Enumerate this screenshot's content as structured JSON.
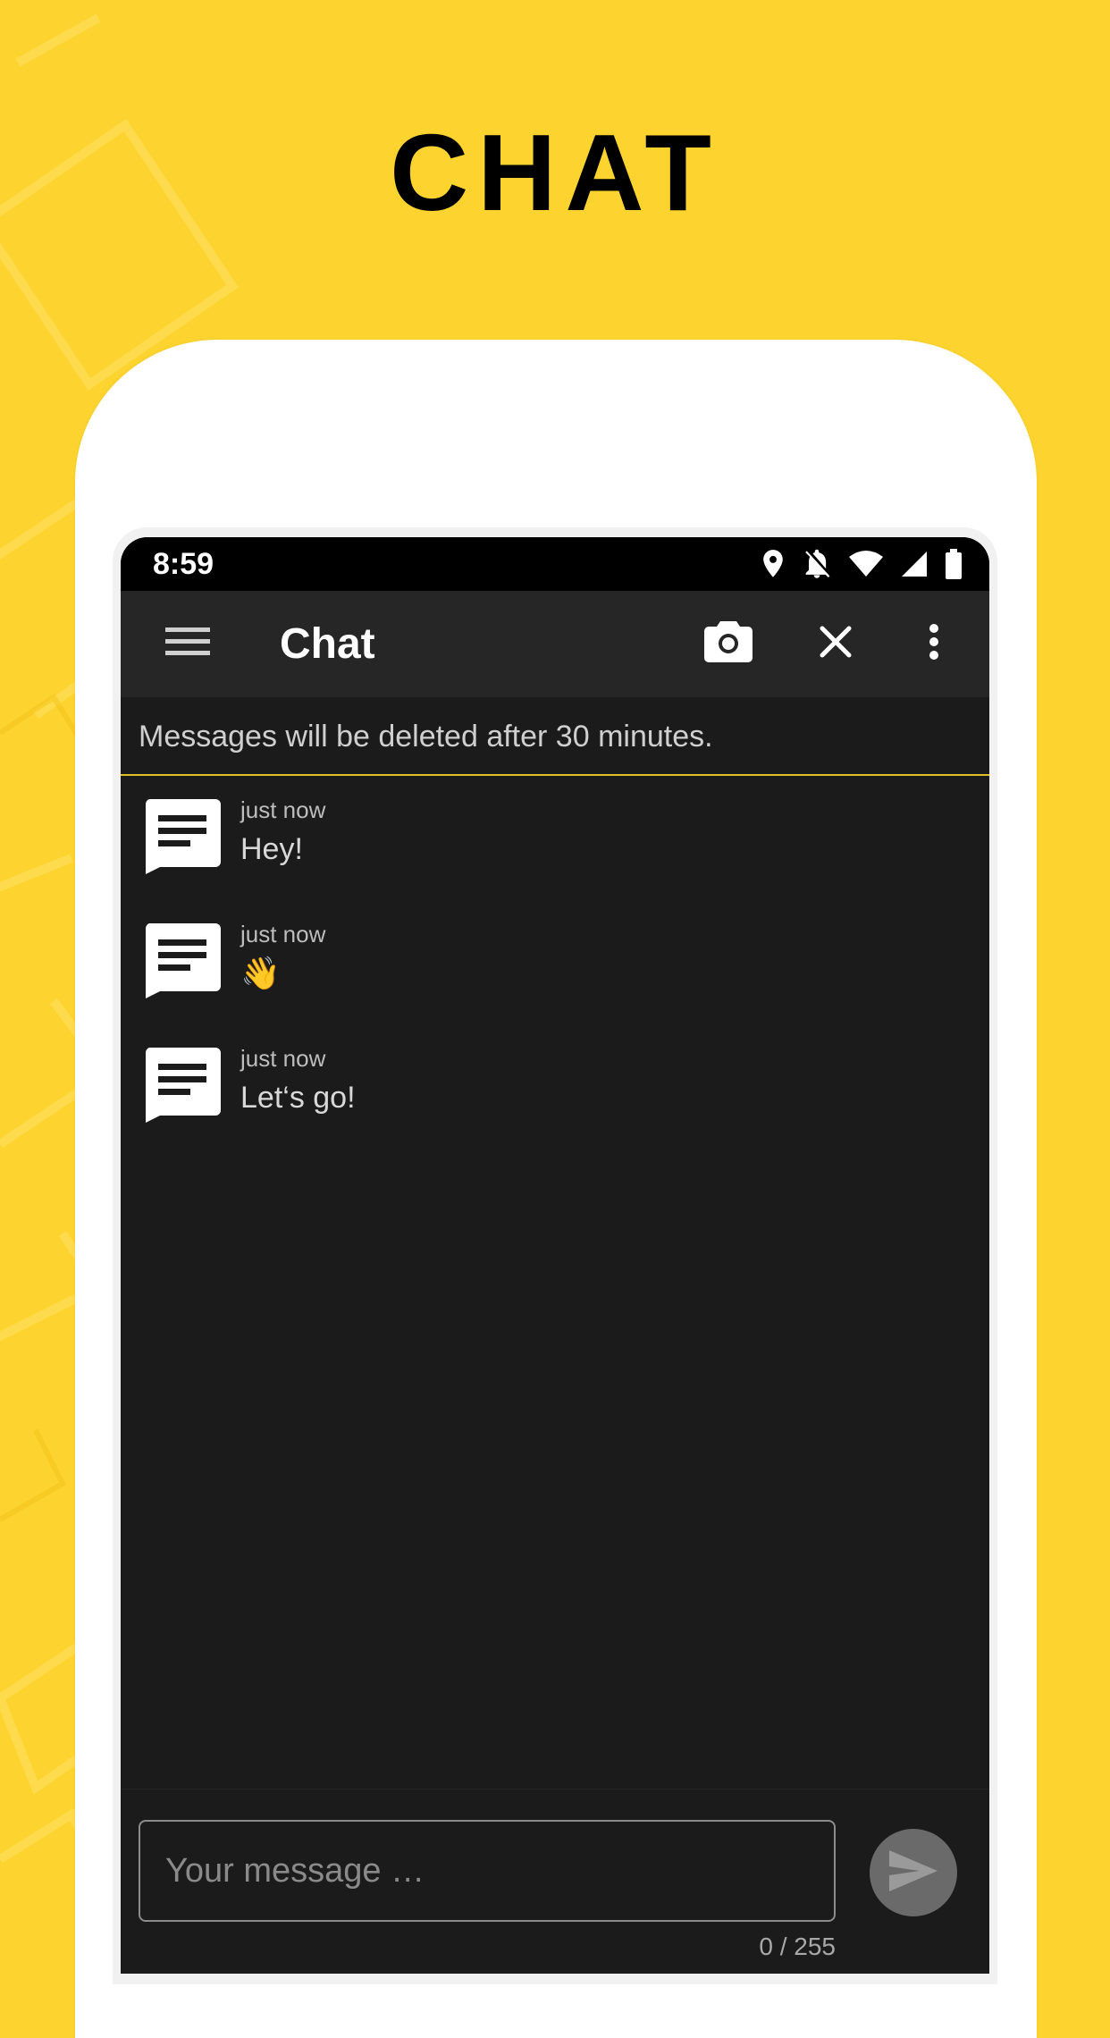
{
  "headline": "CHAT",
  "colors": {
    "background": "#fdd42f",
    "screen": "#1b1b1b",
    "appbar": "#262626",
    "accent": "#e0c12a"
  },
  "statusbar": {
    "time": "8:59",
    "icons": [
      "location-icon",
      "notifications-off-icon",
      "wifi-icon",
      "signal-icon",
      "battery-icon"
    ]
  },
  "appbar": {
    "title": "Chat",
    "icons": [
      "menu-icon",
      "camera-icon",
      "close-icon",
      "more-vert-icon"
    ]
  },
  "notice": "Messages will be deleted after 30 minutes.",
  "messages": [
    {
      "time": "just now",
      "text": "Hey!"
    },
    {
      "time": "just now",
      "text": "👋"
    },
    {
      "time": "just now",
      "text": "Let‘s go!"
    }
  ],
  "composer": {
    "placeholder": "Your message …",
    "value": "",
    "counter": "0 / 255",
    "send_icon": "send-icon"
  }
}
